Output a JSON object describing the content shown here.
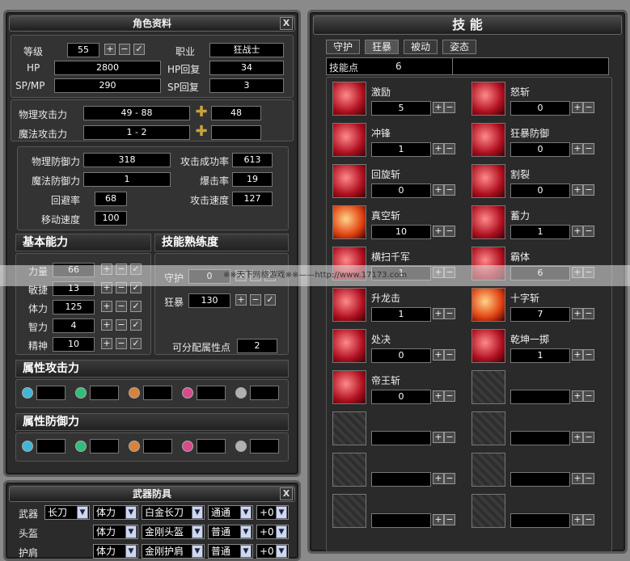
{
  "char": {
    "title": "角色资料",
    "close": "X",
    "level_label": "等级",
    "level": "55",
    "job_label": "职业",
    "job": "狂战士",
    "hp_label": "HP",
    "hp": "2800",
    "hp_regen_label": "HP回复",
    "hp_regen": "34",
    "sp_label": "SP/MP",
    "sp": "290",
    "sp_regen_label": "SP回复",
    "sp_regen": "3",
    "phys_atk_label": "物理攻击力",
    "phys_atk": "49 - 88",
    "phys_atk_bonus": "48",
    "mag_atk_label": "魔法攻击力",
    "mag_atk": "1 - 2",
    "mag_atk_bonus": "",
    "phys_def_label": "物理防御力",
    "phys_def": "318",
    "hit_label": "攻击成功率",
    "hit": "613",
    "mag_def_label": "魔法防御力",
    "mag_def": "1",
    "crit_label": "爆击率",
    "crit": "19",
    "dodge_label": "回避率",
    "dodge": "68",
    "atk_speed_label": "攻击速度",
    "atk_speed": "127",
    "move_label": "移动速度",
    "move": "100",
    "basic_header": "基本能力",
    "mastery_header": "技能熟练度",
    "stats": [
      {
        "label": "力量",
        "value": "66"
      },
      {
        "label": "敏捷",
        "value": "13"
      },
      {
        "label": "体力",
        "value": "125"
      },
      {
        "label": "智力",
        "value": "4"
      },
      {
        "label": "精神",
        "value": "10"
      }
    ],
    "mastery": [
      {
        "label": "守护",
        "value": "0"
      },
      {
        "label": "狂暴",
        "value": "130"
      }
    ],
    "free_points_label": "可分配属性点",
    "free_points": "2",
    "elem_atk_header": "属性攻击力",
    "elem_def_header": "属性防御力",
    "gem_colors": [
      "#3fb8d8",
      "#2fbf7a",
      "#d8823a",
      "#d84a8a",
      "#b0b0b0"
    ]
  },
  "skills": {
    "title": "技 能",
    "tabs": [
      "守护",
      "狂暴",
      "被动",
      "姿态"
    ],
    "points_label": "技能点",
    "points": "6",
    "list": [
      {
        "name": "激励",
        "value": "5"
      },
      {
        "name": "怒斩",
        "value": "0"
      },
      {
        "name": "冲锋",
        "value": "1"
      },
      {
        "name": "狂暴防御",
        "value": "0"
      },
      {
        "name": "回旋斩",
        "value": "0"
      },
      {
        "name": "割裂",
        "value": "0"
      },
      {
        "name": "真空斩",
        "value": "10"
      },
      {
        "name": "蓄力",
        "value": "1"
      },
      {
        "name": "横扫千军",
        "value": "1"
      },
      {
        "name": "霸体",
        "value": "6"
      },
      {
        "name": "升龙击",
        "value": "1"
      },
      {
        "name": "十字斩",
        "value": "7"
      },
      {
        "name": "处决",
        "value": "0"
      },
      {
        "name": "乾坤一掷",
        "value": "1"
      },
      {
        "name": "帝王斩",
        "value": "0"
      }
    ]
  },
  "gear": {
    "title": "武器防具",
    "rows": [
      {
        "slot": "武器",
        "type": "长刀",
        "attr": "体力",
        "grade": "白金长刀",
        "quality": "通通",
        "refine": "+0"
      },
      {
        "slot": "头盔",
        "type": "",
        "attr": "体力",
        "grade": "金刚头盔",
        "quality": "普通",
        "refine": "+0"
      },
      {
        "slot": "护肩",
        "type": "",
        "attr": "体力",
        "grade": "金刚护肩",
        "quality": "普通",
        "refine": "+0"
      }
    ]
  },
  "banner": "※※天下网络游戏※※——http://www.17173.com"
}
